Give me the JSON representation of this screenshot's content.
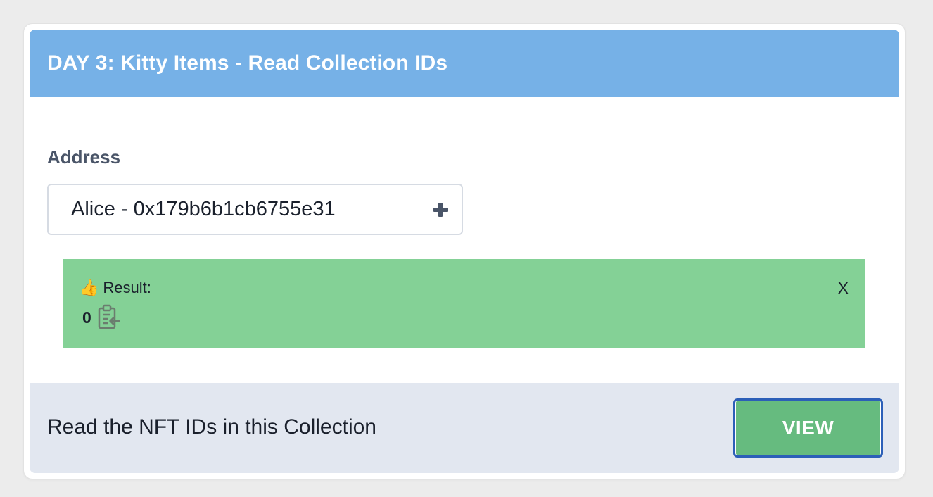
{
  "card": {
    "title": "DAY 3: Kitty Items - Read Collection IDs"
  },
  "address": {
    "label": "Address",
    "selected_value": "Alice - 0x179b6b1cb6755e31",
    "icon": "plus-icon"
  },
  "result": {
    "label": "Result:",
    "emoji": "👍",
    "value": "0",
    "close_label": "X",
    "copy_icon": "clipboard-icon"
  },
  "footer": {
    "description": "Read the NFT IDs in this Collection",
    "button_label": "VIEW"
  },
  "colors": {
    "header": "#76b1e7",
    "result_background": "#84d196",
    "footer_background": "#e2e7f0",
    "button_background": "#66bb7f",
    "button_border": "#2c5fb8"
  }
}
